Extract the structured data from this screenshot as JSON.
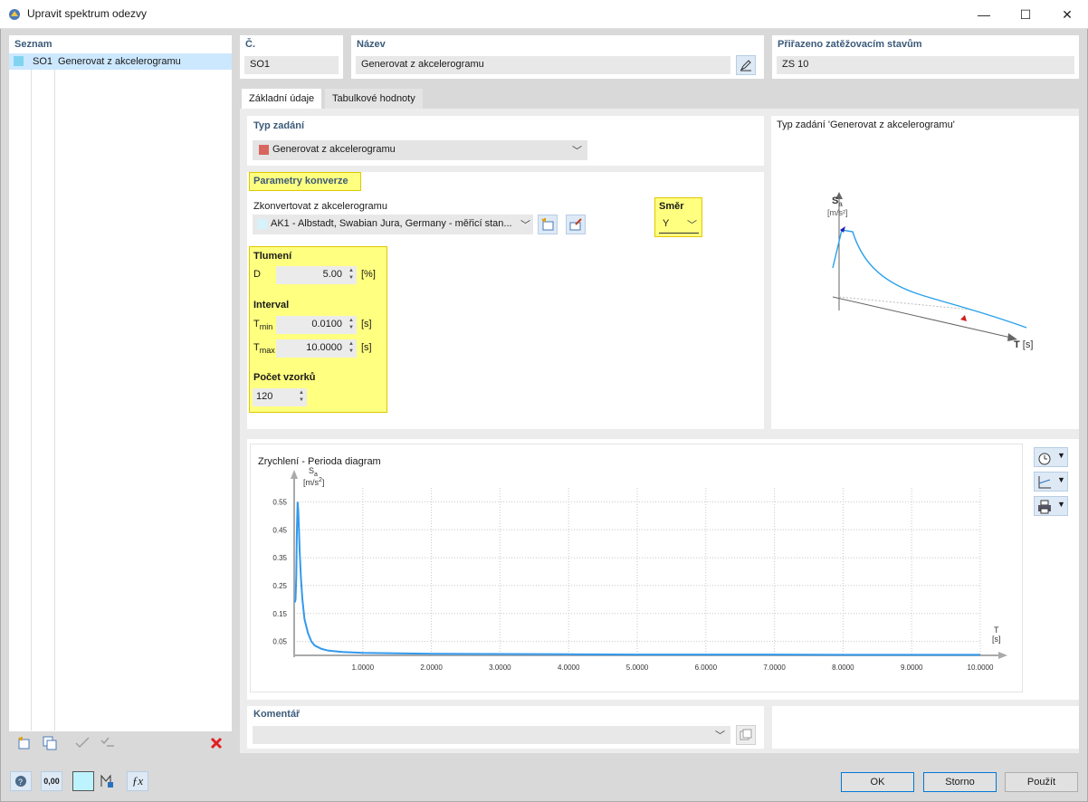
{
  "window": {
    "title": "Upravit spektrum odezvy",
    "minimize": "—",
    "maximize": "☐",
    "close": "✕"
  },
  "list": {
    "header": "Seznam",
    "items": [
      {
        "id": "SO1",
        "label": "Generovat z akcelerogramu",
        "color": "#7fd4f0"
      }
    ]
  },
  "number": {
    "label": "Č.",
    "value": "SO1"
  },
  "name": {
    "label": "Název",
    "value": "Generovat z akcelerogramu"
  },
  "assigned": {
    "label": "Přiřazeno zatěžovacím stavům",
    "value": "ZS 10"
  },
  "tabs": [
    "Základní údaje",
    "Tabulkové hodnoty"
  ],
  "input_type": {
    "header": "Typ zadání",
    "value": "Generovat z akcelerogramu",
    "swatch": "#d9655f"
  },
  "conversion": {
    "header": "Parametry konverze",
    "convert_label": "Zkonvertovat z akcelerogramu",
    "accelerogram": "AK1 - Albstadt, Swabian Jura, Germany - měřicí stan...",
    "direction_label": "Směr",
    "direction_value": "Y",
    "damping_label": "Tlumení",
    "d_label": "D",
    "d_value": "5.00",
    "d_unit": "[%]",
    "interval_label": "Interval",
    "tmin_label": "T",
    "tmin_sub": "min",
    "tmin_value": "0.0100",
    "tmin_unit": "[s]",
    "tmax_label": "T",
    "tmax_sub": "max",
    "tmax_value": "10.0000",
    "tmax_unit": "[s]",
    "samples_label": "Počet vzorků",
    "samples_value": "120"
  },
  "preview": {
    "title": "Typ zadání  'Generovat z akcelerogramu'",
    "y_label": "S",
    "y_sub": "a",
    "y_unit": "[m/s²]",
    "x_label": "T",
    "x_unit": "[s]"
  },
  "diagram": {
    "title": "Zrychlení - Perioda diagram",
    "y_label": "S",
    "y_sub": "a",
    "y_unit_a": "[m/s",
    "y_unit_b": "2",
    "y_unit_c": "]",
    "x_label": "T",
    "x_unit": "[s]",
    "color": "#3399ee"
  },
  "chart_data": {
    "type": "line",
    "title": "Zrychlení - Perioda diagram",
    "xlabel": "T [s]",
    "ylabel": "Sa [m/s2]",
    "xlim": [
      0,
      10
    ],
    "ylim": [
      0,
      0.6
    ],
    "x_ticks": [
      "1.0000",
      "2.0000",
      "3.0000",
      "4.0000",
      "5.0000",
      "6.0000",
      "7.0000",
      "8.0000",
      "9.0000",
      "10.0000"
    ],
    "y_ticks": [
      "0.05",
      "0.15",
      "0.25",
      "0.35",
      "0.45",
      "0.55"
    ],
    "series": [
      {
        "x": [
          0.01,
          0.02,
          0.03,
          0.04,
          0.05,
          0.06,
          0.07,
          0.08,
          0.1,
          0.12,
          0.15,
          0.2,
          0.25,
          0.3,
          0.4,
          0.5,
          0.7,
          1.0,
          1.5,
          2.0,
          3.0,
          4.0,
          5.0,
          6.0,
          7.0,
          8.0,
          9.0,
          10.0
        ],
        "y": [
          0.19,
          0.2,
          0.28,
          0.45,
          0.55,
          0.52,
          0.45,
          0.37,
          0.27,
          0.2,
          0.13,
          0.08,
          0.05,
          0.035,
          0.023,
          0.017,
          0.012,
          0.009,
          0.007,
          0.006,
          0.005,
          0.004,
          0.003,
          0.003,
          0.003,
          0.002,
          0.002,
          0.002
        ]
      }
    ],
    "grid": true
  },
  "comment": {
    "header": "Komentář",
    "value": ""
  },
  "buttons": {
    "ok": "OK",
    "cancel": "Storno",
    "apply": "Použít"
  },
  "numeric_icon": "0,00"
}
